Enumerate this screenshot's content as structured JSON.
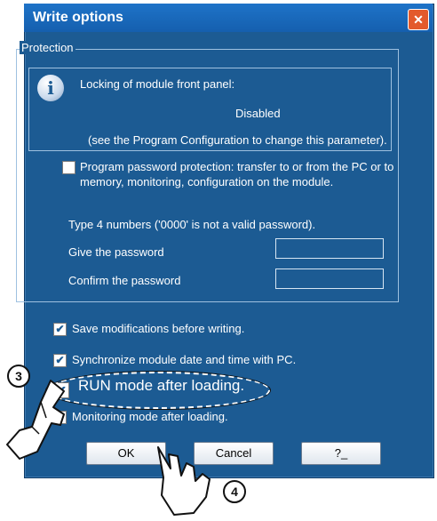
{
  "window": {
    "title": "Write options",
    "close_glyph": "✕"
  },
  "protection": {
    "legend": "Protection",
    "info": {
      "icon": "info-icon",
      "heading": "Locking of module front panel:",
      "value": "Disabled",
      "note": "(see the Program Configuration to change this parameter)."
    },
    "password_protection": {
      "checked": false,
      "line1": "Program password protection: transfer to or from the PC or to",
      "line2": "memory, monitoring, configuration on the module."
    },
    "hint": "Type 4 numbers ('0000' is not a valid password).",
    "give_label": "Give the password",
    "give_value": "",
    "confirm_label": "Confirm the password",
    "confirm_value": ""
  },
  "options": [
    {
      "label": "Save modifications before writing.",
      "checked": true
    },
    {
      "label": "Synchronize module date and time with PC.",
      "checked": true
    },
    {
      "label": "RUN mode after loading.",
      "checked": true
    },
    {
      "label": "Monitoring mode after loading.",
      "checked": false
    }
  ],
  "buttons": {
    "ok": "OK",
    "cancel": "Cancel",
    "help": "?_"
  },
  "annotations": {
    "step3": "3",
    "step4": "4"
  },
  "colors": {
    "dialog_bg": "#1c5b93",
    "titlebar": "#1a6abf",
    "close": "#e35a2c"
  }
}
